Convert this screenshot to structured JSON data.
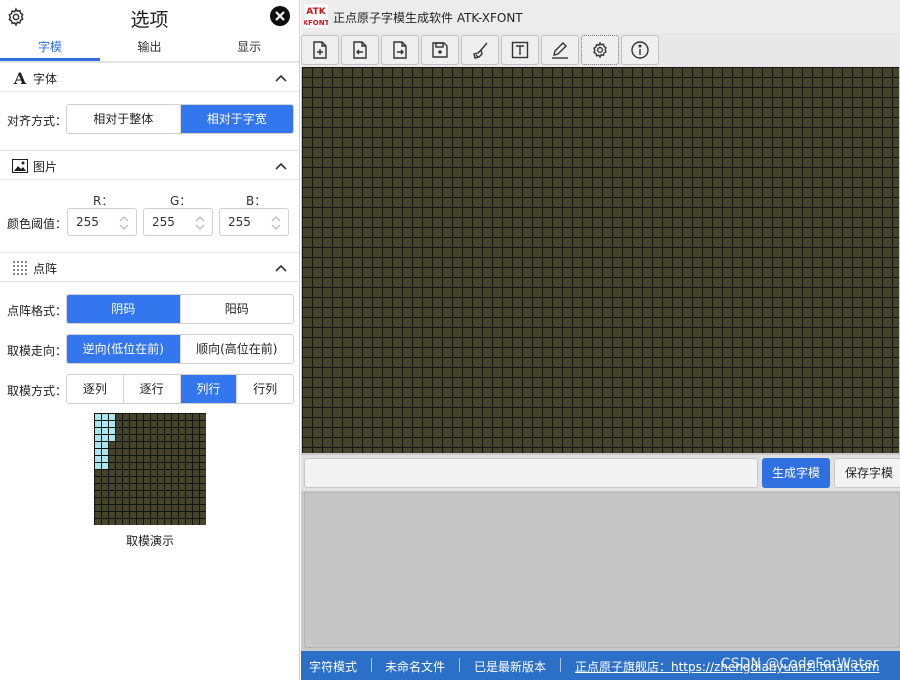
{
  "panel": {
    "title": "选项",
    "tabs": [
      {
        "label": "字模",
        "active": true
      },
      {
        "label": "输出",
        "active": false
      },
      {
        "label": "显示",
        "active": false
      }
    ],
    "font_section": {
      "title": "字体",
      "align_label": "对齐方式：",
      "align_options": [
        "相对于整体",
        "相对于字宽"
      ],
      "align_selected": "相对于字宽"
    },
    "image_section": {
      "title": "图片",
      "threshold_label": "颜色阈值：",
      "channels": [
        {
          "label": "R：",
          "value": "255"
        },
        {
          "label": "G：",
          "value": "255"
        },
        {
          "label": "B：",
          "value": "255"
        }
      ]
    },
    "matrix_section": {
      "title": "点阵",
      "format_label": "点阵格式：",
      "format_options": [
        "阴码",
        "阳码"
      ],
      "format_selected": "阴码",
      "direction_label": "取模走向：",
      "direction_options": [
        "逆向(低位在前)",
        "顺向(高位在前)"
      ],
      "direction_selected": "逆向(低位在前)",
      "mode_label": "取模方式：",
      "mode_options": [
        "逐列",
        "逐行",
        "列行",
        "行列"
      ],
      "mode_selected": "列行",
      "demo_caption": "取模演示"
    }
  },
  "window": {
    "logo_text": [
      "ATK",
      "XFONT"
    ],
    "title": "正点原子字模生成软件 ATK-XFONT",
    "toolbar_icons": [
      "new-file-icon",
      "open-file-icon",
      "import-file-icon",
      "save-file-icon",
      "clear-brush-icon",
      "text-icon",
      "pencil-icon",
      "settings-icon",
      "info-icon"
    ],
    "toolbar_selected": "settings-icon",
    "generate_label": "生成字模",
    "save_label": "保存字模",
    "status": {
      "mode": "字符模式",
      "file": "未命名文件",
      "version": "已是最新版本",
      "shop": "正点原子旗舰店：https://zhengdianyuanzi.tmall.com"
    },
    "watermark": "CSDN @CodeForWater"
  },
  "colors": {
    "accent": "#3476ee",
    "grid_cell": "#44442a",
    "grid_line": "#141410",
    "demo_highlight": "#a9e6ee",
    "statusbar": "#2c6fc7"
  }
}
